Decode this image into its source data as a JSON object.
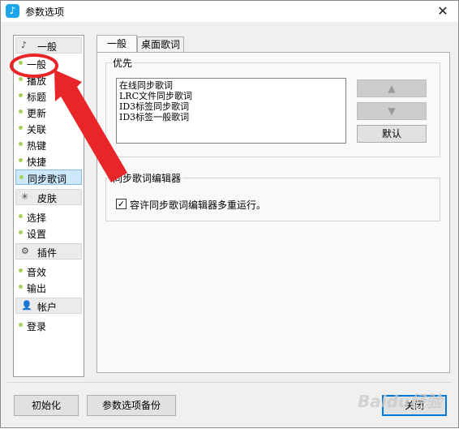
{
  "window": {
    "title": "参数选项",
    "app_icon_glyph": "♪"
  },
  "sidebar": {
    "groups": [
      {
        "label": "一般",
        "icon": "music-note-icon",
        "glyph": "♪",
        "items": [
          "一般",
          "播放",
          "标题",
          "更新",
          "关联",
          "热键",
          "快捷",
          "同步歌词"
        ]
      },
      {
        "label": "皮肤",
        "icon": "skin-icon",
        "glyph": "✳",
        "items": [
          "选择",
          "设置"
        ]
      },
      {
        "label": "插件",
        "icon": "plugin-gear-icon",
        "glyph": "⚙",
        "items": [
          "音效",
          "输出"
        ]
      },
      {
        "label": "帐户",
        "icon": "user-icon",
        "glyph": "👤",
        "items": [
          "登录"
        ]
      }
    ],
    "selected_item": "同步歌词"
  },
  "tabs": [
    {
      "label": "一般",
      "active": true
    },
    {
      "label": "桌面歌词",
      "active": false
    }
  ],
  "priority": {
    "title": "优先",
    "list": [
      "在线同步歌词",
      "LRC文件同步歌词",
      "ID3标签同步歌词",
      "ID3标签一般歌词"
    ],
    "up_glyph": "▲",
    "down_glyph": "▼",
    "default_label": "默认"
  },
  "editor": {
    "title": "同步歌词编辑器",
    "checkbox_label": "容许同步歌词编辑器多重运行。",
    "checkbox_checked": true,
    "check_glyph": "✓"
  },
  "footer": {
    "init_label": "初始化",
    "backup_label": "参数选项备份",
    "close_label": "关闭"
  },
  "close_glyph": "✕",
  "watermark": "Baidu经验",
  "annotation_color": "#e8262a"
}
